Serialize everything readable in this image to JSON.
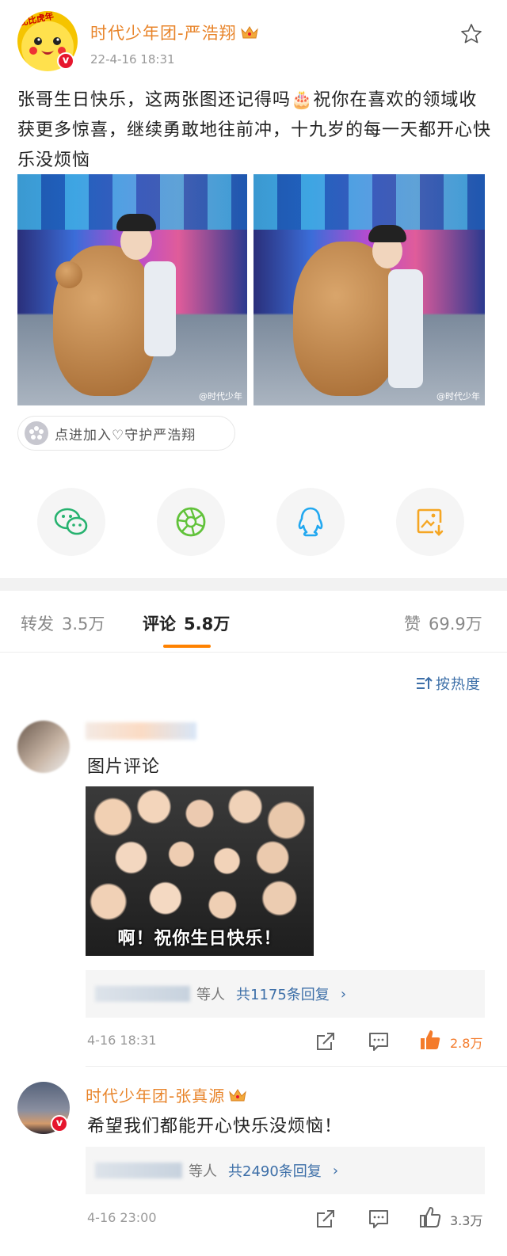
{
  "post": {
    "author": "时代少年团-严浩翔",
    "time": "22-4-16 18:31",
    "text": "张哥生日快乐，这两张图还记得吗🎂祝你在喜欢的领域收获更多惊喜，继续勇敢地往前冲，十九岁的每一天都开心快乐没烦恼",
    "image_watermark": "@时代少年",
    "guard_label": "点进加入♡守护严浩翔",
    "avatar_tag": "比比虎年"
  },
  "share": [
    "wechat-icon",
    "moments-icon",
    "qq-icon",
    "save-image-icon"
  ],
  "tabs": {
    "repost_label": "转发",
    "repost_count": "3.5万",
    "comment_label": "评论",
    "comment_count": "5.8万",
    "like_label": "赞",
    "like_count": "69.9万"
  },
  "sort": {
    "label": "按热度"
  },
  "comments": [
    {
      "text": "图片评论",
      "image_caption": "啊！祝你生日快乐！",
      "reply_who": "等人",
      "reply_count": "共1175条回复",
      "chevron": "›",
      "time": "4-16 18:31",
      "likes": "2.8万",
      "liked": true
    },
    {
      "author": "时代少年团-张真源",
      "text": "希望我们都能开心快乐没烦恼！",
      "reply_who": "等人",
      "reply_count": "共2490条回复",
      "chevron": "›",
      "time": "4-16 23:00",
      "likes": "3.3万",
      "liked": false
    }
  ],
  "colors": {
    "accent_orange": "#ff8200",
    "name_orange": "#e8842a",
    "link_blue": "#3d6fa8",
    "verified_red": "#e6162d"
  }
}
